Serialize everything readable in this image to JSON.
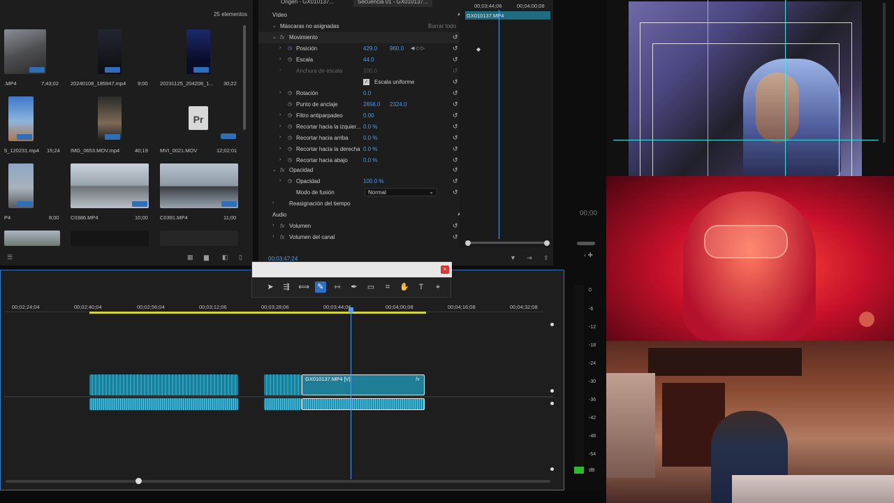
{
  "project": {
    "count": "25 elementos",
    "items": [
      {
        "name": ".MP4",
        "duration": "7;43;02"
      },
      {
        "name": "20240108_185947.mp4",
        "duration": "9;00"
      },
      {
        "name": "20231125_204208_1...",
        "duration": "30;22"
      },
      {
        "name": "5_120231.mp4",
        "duration": "15;24"
      },
      {
        "name": "IMG_0653.MOV.mp4",
        "duration": "40;19"
      },
      {
        "name": "MVI_0021.MOV",
        "duration": "12;02;01"
      },
      {
        "name": "P4",
        "duration": "8;00"
      },
      {
        "name": "C0386.MP4",
        "duration": "10;00"
      },
      {
        "name": "C0391.MP4",
        "duration": "11;00"
      }
    ]
  },
  "effects": {
    "tab_origin": "Origen - GX010137...",
    "tab_sequence": "Secuencia 01 - GX010137...",
    "section_video": "Vídeo",
    "masks": "Máscaras no asignadas",
    "clear_all": "Borrar todo",
    "motion": "Movimiento",
    "position_label": "Posición",
    "position_x": "429.0",
    "position_y": "960.0",
    "scale_label": "Escala",
    "scale_value": "44.0",
    "scale_width_label": "Anchura de escala",
    "scale_width_value": "100.0",
    "uniform_scale": "Escala uniforme",
    "rotation_label": "Rotación",
    "rotation_value": "0.0",
    "anchor_label": "Punto de anclaje",
    "anchor_x": "2656.0",
    "anchor_y": "2324.0",
    "antiflicker_label": "Filtro antiparpadeo",
    "antiflicker_value": "0.00",
    "crop_left_label": "Recortar hacia la izquier...",
    "crop_left_value": "0.0 %",
    "crop_top_label": "Recortar hacia arriba",
    "crop_top_value": "0.0 %",
    "crop_right_label": "Recortar hacia la derecha",
    "crop_right_value": "0.0 %",
    "crop_bottom_label": "Recortar hacia abajo",
    "crop_bottom_value": "0.0 %",
    "opacity_section": "Opacidad",
    "opacity_label": "Opacidad",
    "opacity_value": "100.0 %",
    "blend_label": "Modo de fusión",
    "blend_value": "Normal",
    "time_remap": "Reasignación del tiempo",
    "section_audio": "Audio",
    "volume": "Volumen",
    "channel_volume": "Volumen del canal",
    "timecode": "00;03;47;24",
    "mini_clip": "GX010137.MP4",
    "mini_time1": "00;03;44;06",
    "mini_time2": "00;04;00;08"
  },
  "monitor": {
    "timecode": "00;00"
  },
  "timeline": {
    "ruler": [
      "00;02;24;04",
      "00;02;40;04",
      "00;02;56;04",
      "00;03;12;06",
      "00;03;28;06",
      "00;03;44;06",
      "00;04;00;08",
      "00;04;16;08",
      "00;04;32;08"
    ],
    "clip_label": "GX010137.MP4 [V]",
    "fx_badge": "fx"
  },
  "meter": {
    "labels": [
      "0",
      "-6",
      "-12",
      "-18",
      "-24",
      "-30",
      "-36",
      "-42",
      "-48",
      "-54",
      "dB"
    ]
  },
  "colors": {
    "accent": "#4b9bf0",
    "clip": "#1f7d96",
    "audio": "#1a8fb0"
  }
}
